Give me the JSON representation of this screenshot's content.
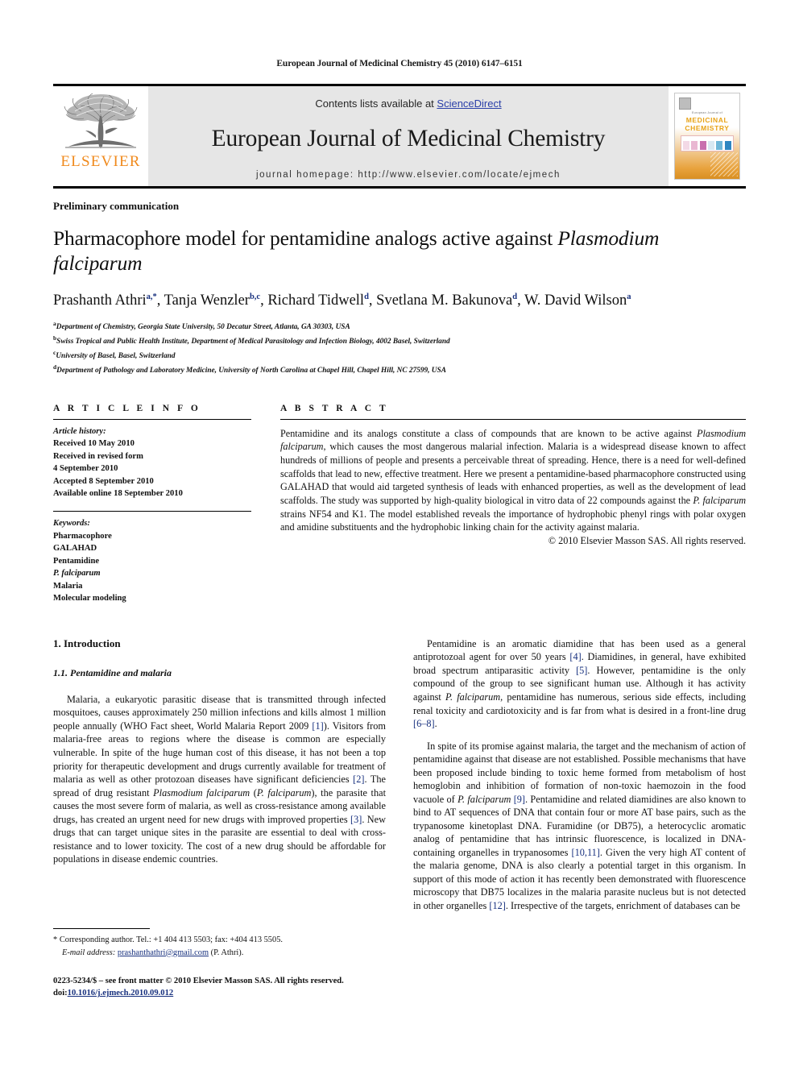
{
  "running_head": "European Journal of Medicinal Chemistry 45 (2010) 6147–6151",
  "masthead": {
    "publisher_name": "ELSEVIER",
    "contents_prefix": "Contents lists available at ",
    "sciencedirect": "ScienceDirect",
    "journal_title": "European Journal of Medicinal Chemistry",
    "homepage": "journal homepage: http://www.elsevier.com/locate/ejmech",
    "cover": {
      "publisher_tiny": "ELSEVIER",
      "line1": "European Journal of",
      "line2": "MEDICINAL",
      "line3": "CHEMISTRY"
    }
  },
  "article": {
    "type": "Preliminary communication",
    "title_part1": "Pharmacophore model for pentamidine analogs active against ",
    "title_italic": "Plasmodium falciparum",
    "authors": [
      {
        "name": "Prashanth Athri",
        "sup": "a,*"
      },
      {
        "name": "Tanja Wenzler",
        "sup": "b,c"
      },
      {
        "name": "Richard Tidwell",
        "sup": "d"
      },
      {
        "name": "Svetlana M. Bakunova",
        "sup": "d"
      },
      {
        "name": "W. David Wilson",
        "sup": "a"
      }
    ],
    "affiliations": [
      {
        "sup": "a",
        "text": "Department of Chemistry, Georgia State University, 50 Decatur Street, Atlanta, GA 30303, USA"
      },
      {
        "sup": "b",
        "text": "Swiss Tropical and Public Health Institute, Department of Medical Parasitology and Infection Biology, 4002 Basel, Switzerland"
      },
      {
        "sup": "c",
        "text": "University of Basel, Basel, Switzerland"
      },
      {
        "sup": "d",
        "text": "Department of Pathology and Laboratory Medicine, University of North Carolina at Chapel Hill, Chapel Hill, NC 27599, USA"
      }
    ]
  },
  "article_info": {
    "heading": "A R T I C L E  I N F O",
    "history_label": "Article history:",
    "history": [
      "Received 10 May 2010",
      "Received in revised form",
      "4 September 2010",
      "Accepted 8 September 2010",
      "Available online 18 September 2010"
    ],
    "keywords_label": "Keywords:",
    "keywords": [
      {
        "text": "Pharmacophore",
        "italic": false
      },
      {
        "text": "GALAHAD",
        "italic": false
      },
      {
        "text": "Pentamidine",
        "italic": false
      },
      {
        "text": "P. falciparum",
        "italic": true
      },
      {
        "text": "Malaria",
        "italic": false
      },
      {
        "text": "Molecular modeling",
        "italic": false
      }
    ]
  },
  "abstract": {
    "heading": "A B S T R A C T",
    "text_parts": [
      {
        "t": "Pentamidine and its analogs constitute a class of compounds that are known to be active against ",
        "i": false
      },
      {
        "t": "Plasmodium falciparum",
        "i": true
      },
      {
        "t": ", which causes the most dangerous malarial infection. Malaria is a widespread disease known to affect hundreds of millions of people and presents a perceivable threat of spreading. Hence, there is a need for well-defined scaffolds that lead to new, effective treatment. Here we present a pentamidine-based pharmacophore constructed using GALAHAD that would aid targeted synthesis of leads with enhanced properties, as well as the development of lead scaffolds. The study was supported by high-quality biological in vitro data of 22 compounds against the ",
        "i": false
      },
      {
        "t": "P. falciparum",
        "i": true
      },
      {
        "t": " strains NF54 and K1. The model established reveals the importance of hydrophobic phenyl rings with polar oxygen and amidine substituents and the hydrophobic linking chain for the activity against malaria.",
        "i": false
      }
    ],
    "copyright": "© 2010 Elsevier Masson SAS. All rights reserved."
  },
  "body": {
    "section1_heading": "1.  Introduction",
    "section11_heading": "1.1.  Pentamidine and malaria",
    "left_paragraphs": [
      [
        {
          "t": "Malaria, a eukaryotic parasitic disease that is transmitted through infected mosquitoes, causes approximately 250 million infections and kills almost 1 million people annually (WHO Fact sheet, World Malaria Report 2009 ",
          "i": false
        },
        {
          "t": "[1]",
          "i": false,
          "ref": true
        },
        {
          "t": "). Visitors from malaria-free areas to regions where the disease is common are especially vulnerable. In spite of the huge human cost of this disease, it has not been a top priority for therapeutic development and drugs currently available for treatment of malaria as well as other protozoan diseases have significant deficiencies ",
          "i": false
        },
        {
          "t": "[2]",
          "i": false,
          "ref": true
        },
        {
          "t": ". The spread of drug resistant ",
          "i": false
        },
        {
          "t": "Plasmodium falciparum",
          "i": true
        },
        {
          "t": " (",
          "i": false
        },
        {
          "t": "P. falciparum",
          "i": true
        },
        {
          "t": "), the parasite that causes the most severe form of malaria, as well as cross-resistance among available drugs, has created an urgent need for new drugs with improved properties ",
          "i": false
        },
        {
          "t": "[3]",
          "i": false,
          "ref": true
        },
        {
          "t": ". New drugs that can target unique sites in the parasite are essential to deal with cross-resistance and to lower toxicity. The cost of a new drug should be affordable for populations in disease endemic countries.",
          "i": false
        }
      ]
    ],
    "right_paragraphs": [
      [
        {
          "t": "Pentamidine is an aromatic diamidine that has been used as a general antiprotozoal agent for over 50 years ",
          "i": false
        },
        {
          "t": "[4]",
          "i": false,
          "ref": true
        },
        {
          "t": ". Diamidines, in general, have exhibited broad spectrum antiparasitic activity ",
          "i": false
        },
        {
          "t": "[5]",
          "i": false,
          "ref": true
        },
        {
          "t": ". However, pentamidine is the only compound of the group to see significant human use. Although it has activity against ",
          "i": false
        },
        {
          "t": "P. falciparum",
          "i": true
        },
        {
          "t": ", pentamidine has numerous, serious side effects, including renal toxicity and cardiotoxicity and is far from what is desired in a front-line drug ",
          "i": false
        },
        {
          "t": "[6–8]",
          "i": false,
          "ref": true
        },
        {
          "t": ".",
          "i": false
        }
      ],
      [
        {
          "t": "In spite of its promise against malaria, the target and the mechanism of action of pentamidine against that disease are not established. Possible mechanisms that have been proposed include binding to toxic heme formed from metabolism of host hemoglobin and inhibition of formation of non-toxic haemozoin in the food vacuole of ",
          "i": false
        },
        {
          "t": "P. falciparum",
          "i": true
        },
        {
          "t": " ",
          "i": false
        },
        {
          "t": "[9]",
          "i": false,
          "ref": true
        },
        {
          "t": ". Pentamidine and related diamidines are also known to bind to AT sequences of DNA that contain four or more AT base pairs, such as the trypanosome kinetoplast DNA. Furamidine (or DB75), a heterocyclic aromatic analog of pentamidine that has intrinsic fluorescence, is localized in DNA-containing organelles in trypanosomes ",
          "i": false
        },
        {
          "t": "[10,11]",
          "i": false,
          "ref": true
        },
        {
          "t": ". Given the very high AT content of the malaria genome, DNA is also clearly a potential target in this organism. In support of this mode of action it has recently been demonstrated with fluorescence microscopy that DB75 localizes in the malaria parasite nucleus but is not detected in other organelles ",
          "i": false
        },
        {
          "t": "[12]",
          "i": false,
          "ref": true
        },
        {
          "t": ". Irrespective of the targets, enrichment of databases can be",
          "i": false
        }
      ]
    ]
  },
  "footnote": {
    "star": "*",
    "corresponding": "Corresponding author. Tel.: +1 404 413 5503; fax: +404 413 5505.",
    "email_label": "E-mail address:",
    "email": "prashanthathri@gmail.com",
    "email_suffix": "(P. Athri)."
  },
  "imprint": {
    "issn_line": "0223-5234/$ – see front matter © 2010 Elsevier Masson SAS. All rights reserved.",
    "doi_label": "doi:",
    "doi_value": "10.1016/j.ejmech.2010.09.012"
  }
}
